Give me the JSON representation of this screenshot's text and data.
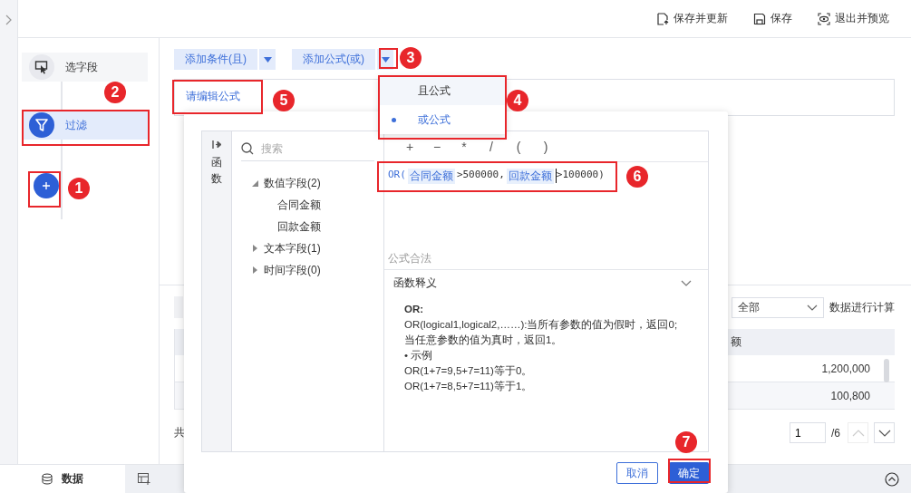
{
  "top_actions": [
    {
      "label": "保存并更新",
      "kind": "save_update"
    },
    {
      "label": "保存",
      "kind": "save"
    },
    {
      "label": "退出并预览",
      "kind": "preview"
    }
  ],
  "steps": [
    {
      "label": "选字段",
      "kind": "select",
      "selected": false
    },
    {
      "label": "过滤",
      "kind": "filter",
      "selected": true
    }
  ],
  "toolbar": [
    {
      "label": "添加条件(且)"
    },
    {
      "label": "添加公式(或)"
    }
  ],
  "edit_link": "请编辑公式",
  "dropdown": [
    {
      "label": "且公式",
      "hovered": true,
      "selected": false
    },
    {
      "label": "或公式",
      "hovered": false,
      "selected": true
    }
  ],
  "dialog": {
    "side_tab": "函数",
    "search": {
      "placeholder": "搜索"
    },
    "tree": [
      {
        "label": "数值字段(2)",
        "expanded": true,
        "children": [
          {
            "label": "合同金额"
          },
          {
            "label": "回款金额"
          }
        ]
      },
      {
        "label": "文本字段(1)",
        "expanded": false
      },
      {
        "label": "时间字段(0)",
        "expanded": false
      }
    ],
    "operators": [
      "+",
      "−",
      "*",
      "/",
      "(",
      ")"
    ],
    "formula": [
      {
        "kind": "func",
        "text": "OR("
      },
      {
        "kind": "field",
        "text": "合同金额"
      },
      {
        "kind": "text",
        "text": ">500000,"
      },
      {
        "kind": "field",
        "text": "回款金额"
      },
      {
        "kind": "cursor"
      },
      {
        "kind": "text",
        "text": ">100000)"
      }
    ],
    "status": "公式合法",
    "help": {
      "title": "函数释义",
      "expanded": true,
      "heading": "OR:",
      "lines": [
        "OR(logical1,logical2,……):当所有参数的值为假时，返回0;",
        "当任意参数的值为真时，返回1。",
        "• 示例",
        "OR(1+7=9,5+7=11)等于0。",
        "OR(1+7=8,5+7=11)等于1。"
      ]
    },
    "buttons": [
      {
        "label": "取消",
        "kind": "secondary"
      },
      {
        "label": "确定",
        "kind": "primary"
      }
    ]
  },
  "calc_row": {
    "select_value": "全部",
    "suffix": "数据进行计算"
  },
  "table": {
    "header": "额",
    "rows": [
      {
        "value": "1,200,000"
      },
      {
        "value": "100,800"
      }
    ]
  },
  "footer": {
    "total": "共",
    "page": "1",
    "pages": "/6"
  },
  "bottom_tabs": [
    {
      "label": "数据",
      "selected": true
    }
  ],
  "annotations": [
    {
      "number": "1"
    },
    {
      "number": "2"
    },
    {
      "number": "3"
    },
    {
      "number": "4"
    },
    {
      "number": "5"
    },
    {
      "number": "6"
    },
    {
      "number": "7"
    }
  ]
}
